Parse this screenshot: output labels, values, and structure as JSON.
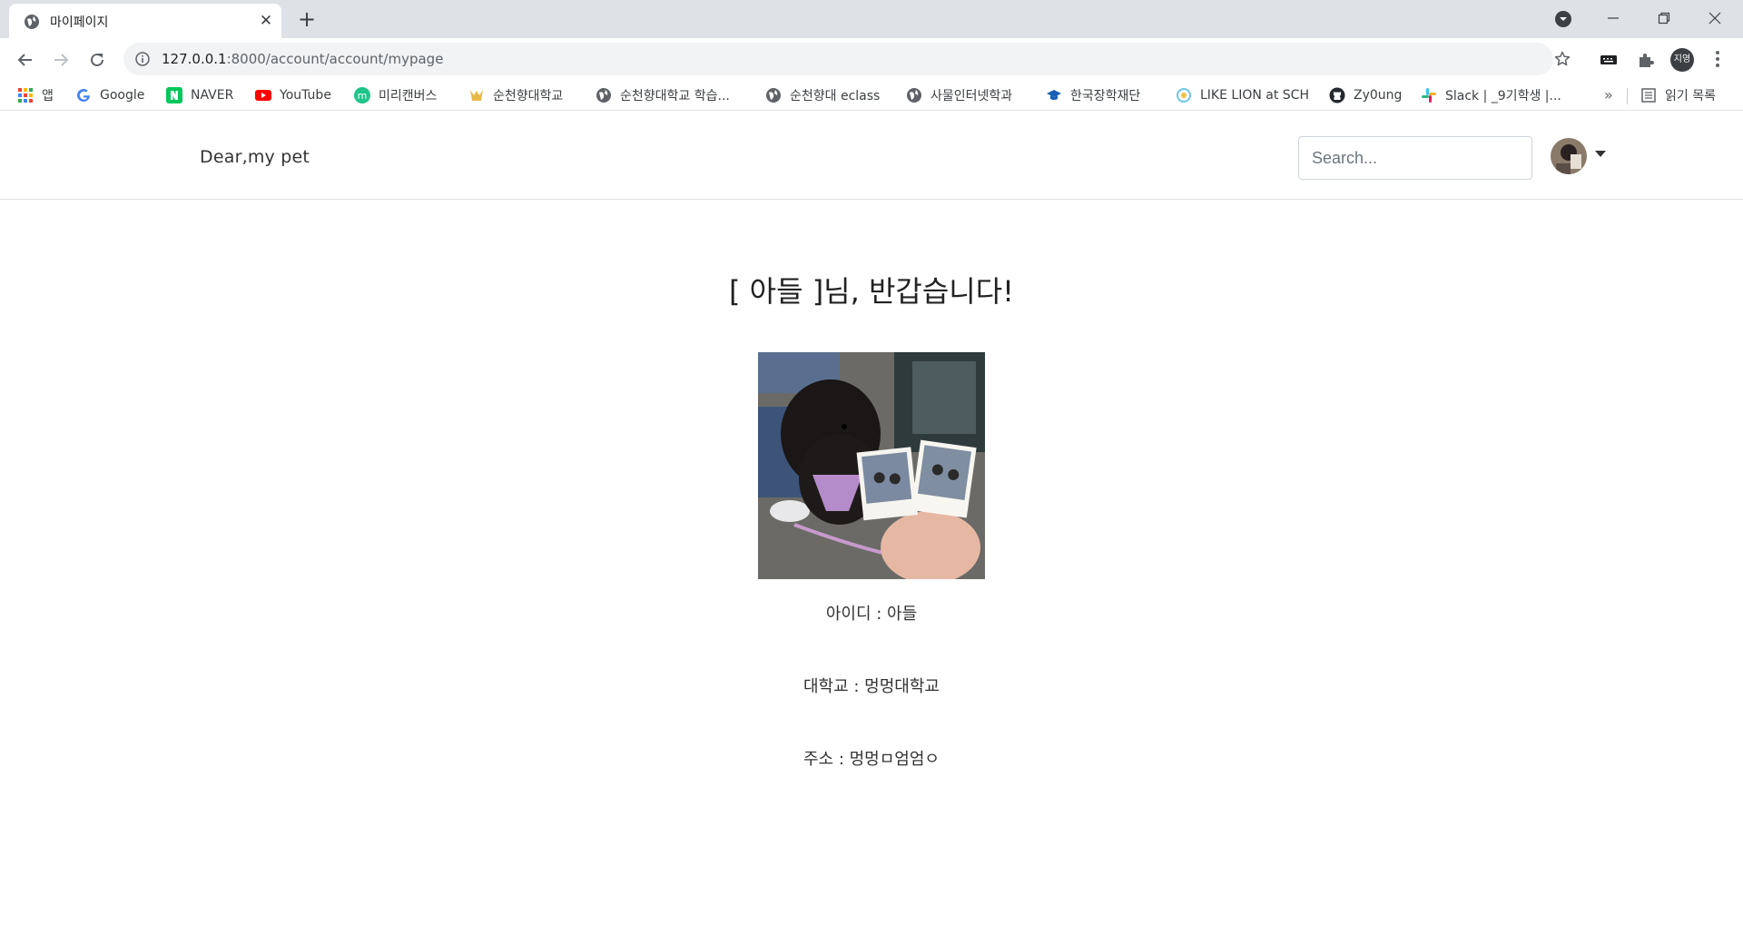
{
  "browser": {
    "tab_title": "마이페이지",
    "url_host": "127.0.0.1",
    "url_rest": ":8000/account/account/mypage",
    "profile_initials": "지영"
  },
  "bookmarks": [
    {
      "label": "앱",
      "icon": "apps-grid-icon",
      "color": "#ea4335"
    },
    {
      "label": "Google",
      "icon": "google-icon",
      "color": "#4285f4"
    },
    {
      "label": "NAVER",
      "icon": "naver-icon",
      "color": "#03c75a"
    },
    {
      "label": "YouTube",
      "icon": "youtube-icon",
      "color": "#ff0000"
    },
    {
      "label": "미리캔버스",
      "icon": "miricanvas-icon",
      "color": "#1fc48a"
    },
    {
      "label": "순천향대학교",
      "icon": "university-crest-icon",
      "color": "#e8b84a"
    },
    {
      "label": "순천향대학교 학습...",
      "icon": "globe-icon",
      "color": "#5f6368"
    },
    {
      "label": "순천향대 eclass",
      "icon": "globe-icon",
      "color": "#5f6368"
    },
    {
      "label": "사물인터넷학과",
      "icon": "globe-icon",
      "color": "#5f6368"
    },
    {
      "label": "한국장학재단",
      "icon": "graduation-cap-icon",
      "color": "#1a5fb4"
    },
    {
      "label": "LIKE LION at SCH",
      "icon": "likelion-icon",
      "color": "#6ec6e6"
    },
    {
      "label": "Zy0ung",
      "icon": "github-icon",
      "color": "#24292e"
    },
    {
      "label": "Slack | _9기학생 |...",
      "icon": "slack-icon",
      "color": "#e01e5a"
    }
  ],
  "bookmarks_more": "»",
  "reading_list": "읽기 목록",
  "site": {
    "brand": "Dear,my pet",
    "search_placeholder": "Search..."
  },
  "profile": {
    "greeting": "[ 아들 ]님, 반갑습니다!",
    "id_line": "아이디 : 아들",
    "university_line": "대학교 : 멍멍대학교",
    "address_line": "주소 : 멍멍ㅁ엄엄ㅇ"
  }
}
